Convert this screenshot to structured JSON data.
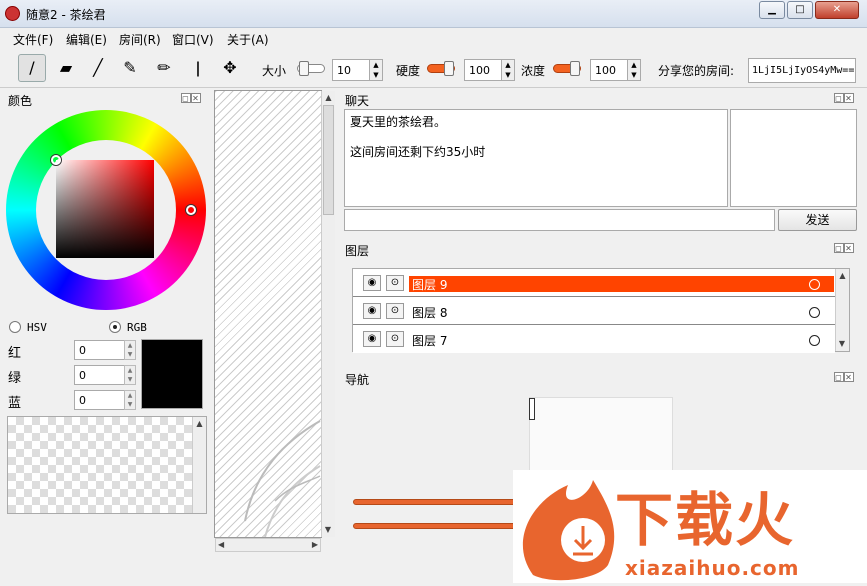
{
  "window": {
    "title": "随意2 - 茶绘君",
    "buttons": {
      "minimize": "▁",
      "maximize": "□",
      "close": "✕"
    }
  },
  "menu": [
    "文件(F)",
    "编辑(E)",
    "房间(R)",
    "窗口(V)",
    "关于(A)"
  ],
  "toolbar": {
    "tools": [
      "pen-icon",
      "eraser-icon",
      "brush-icon",
      "marker-icon",
      "pencil-icon",
      "dropper-icon",
      "move-icon"
    ],
    "size_label": "大小",
    "size_value": "10",
    "hardness_label": "硬度",
    "hardness_value": "100",
    "density_label": "浓度",
    "density_value": "100",
    "share_label": "分享您的房间:",
    "room_code": "1LjI5LjIyOS4yMw=="
  },
  "color_panel": {
    "title": "颜色",
    "modes": [
      "HSV",
      "RGB"
    ],
    "selected_mode": "RGB",
    "red_label": "红",
    "green_label": "绿",
    "blue_label": "蓝",
    "red": "0",
    "green": "0",
    "blue": "0",
    "current_color": "#000000"
  },
  "chat_panel": {
    "title": "聊天",
    "messages": [
      "夏天里的茶绘君。",
      "这间房间还剩下约35小时"
    ],
    "send_label": "发送"
  },
  "layers_panel": {
    "title": "图层",
    "layers": [
      {
        "name": "图层 9",
        "selected": true
      },
      {
        "name": "图层 8",
        "selected": false
      },
      {
        "name": "图层 7",
        "selected": false
      }
    ]
  },
  "navigator_panel": {
    "title": "导航"
  },
  "watermark": {
    "text": "下载火",
    "url": "xiazaihuo.com"
  },
  "colors": {
    "accent": "#ff4400",
    "logo": "#e8652e"
  }
}
